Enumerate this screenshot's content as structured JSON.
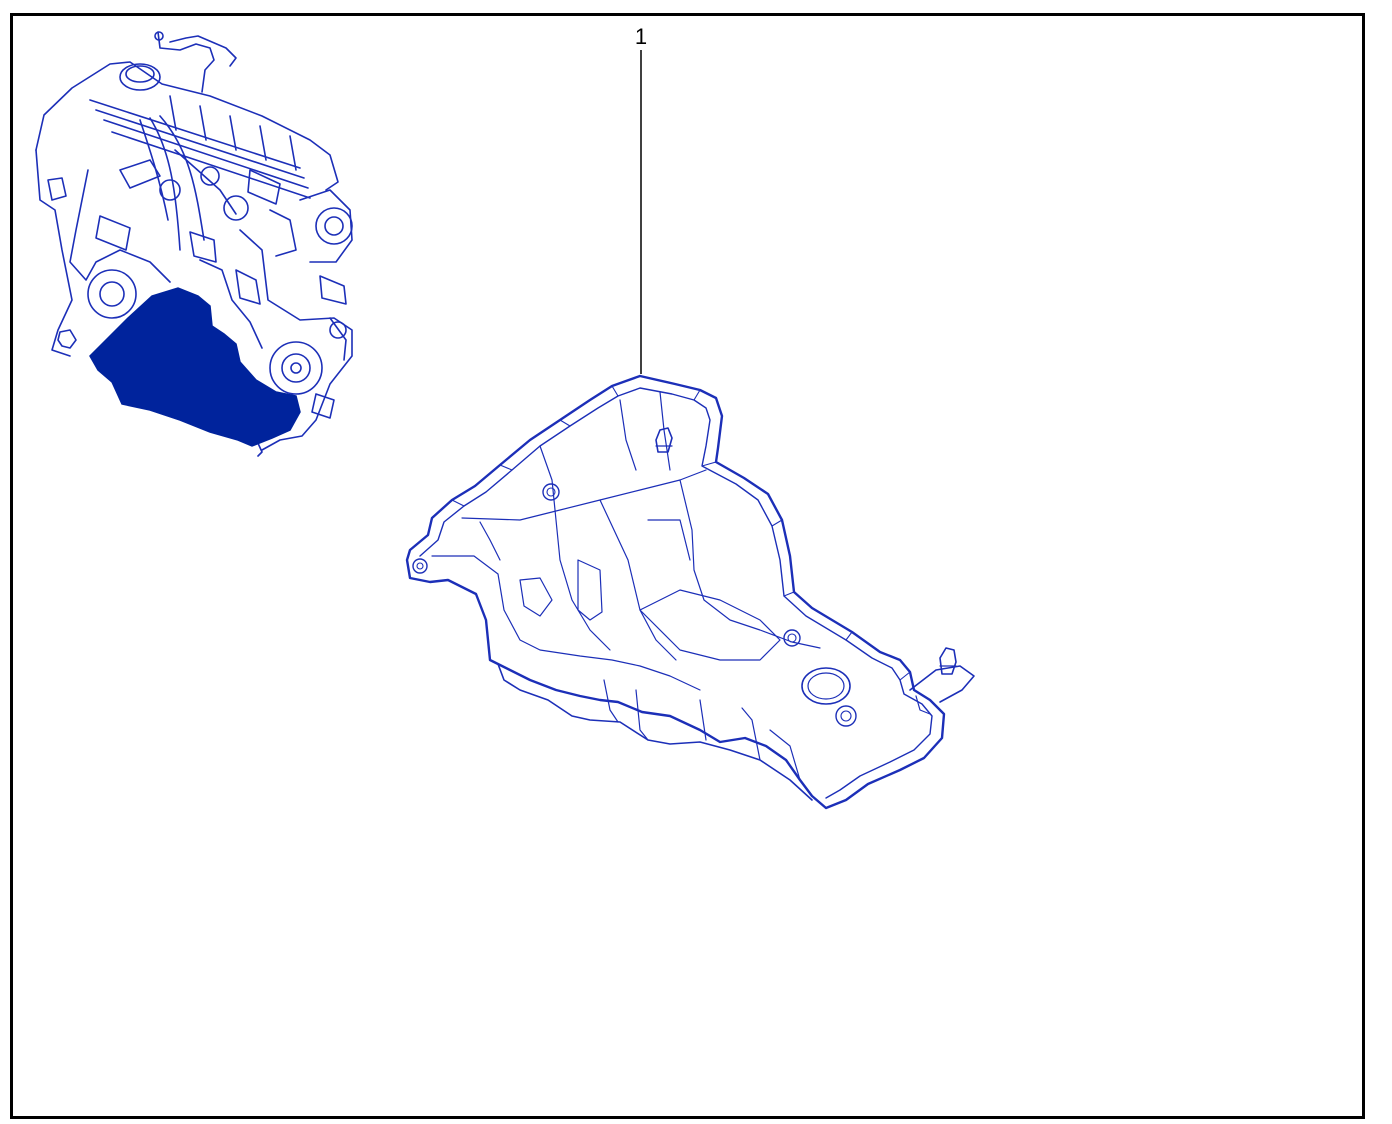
{
  "diagram": {
    "callouts": [
      {
        "label": "1"
      }
    ],
    "colors": {
      "line": "#1c2fb8",
      "highlight": "#00239c",
      "frame": "#000000",
      "leader": "#000000"
    }
  }
}
